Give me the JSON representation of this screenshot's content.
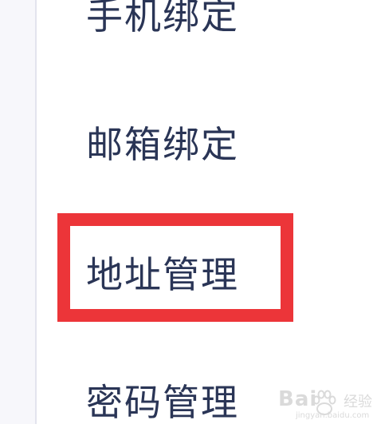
{
  "menu": {
    "items": [
      {
        "label": "手机绑定"
      },
      {
        "label": "邮箱绑定"
      },
      {
        "label": "地址管理",
        "highlighted": true
      },
      {
        "label": "密码管理"
      }
    ]
  },
  "highlight": {
    "color": "#ec3539",
    "target": "地址管理"
  },
  "watermark": {
    "brand": "Bai",
    "cn": "经验",
    "domain": "jingyan.baidu.com",
    "icon": "baidu-paw-icon"
  },
  "colors": {
    "text": "#2a3556",
    "rail": "#f7f7fb",
    "rail_line": "#e3e4ee"
  }
}
